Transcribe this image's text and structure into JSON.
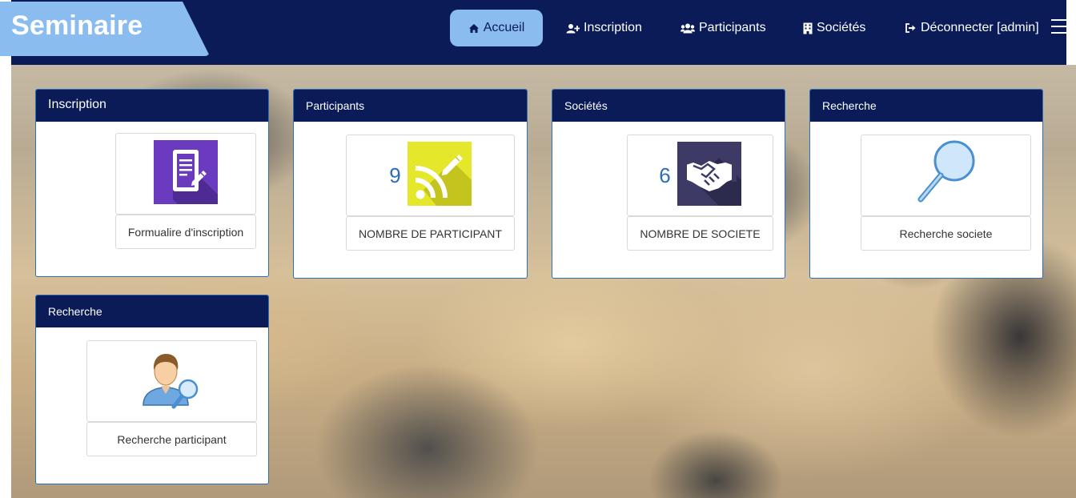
{
  "brand": "Seminaire",
  "nav": {
    "home": "Accueil",
    "inscription": "Inscription",
    "participants": "Participants",
    "societes": "Sociétés",
    "logout": "Déconnecter [admin]"
  },
  "cards": {
    "inscription": {
      "title": "Inscription",
      "label": "Formualire d'inscription"
    },
    "participants": {
      "title": "Participants",
      "count": "9",
      "label": "NOMBRE DE PARTICIPANT"
    },
    "societes": {
      "title": "Sociétés",
      "count": "6",
      "label": "NOMBRE DE SOCIETE"
    },
    "recherche_societe": {
      "title": "Recherche",
      "label": "Recherche societe"
    },
    "recherche_participant": {
      "title": "Recherche",
      "label": "Recherche participant"
    }
  },
  "colors": {
    "navbar": "#0a1b57",
    "brand_bg": "#8bbcef",
    "accent": "#2a6fb8",
    "icon_purple": "#6a3bbf",
    "icon_yellow": "#e5e82a",
    "icon_slate": "#3d3a66"
  },
  "icons": {
    "home": "home-icon",
    "inscription": "user-plus-icon",
    "participants": "users-icon",
    "societes": "building-icon",
    "logout": "sign-out-icon",
    "menu": "hamburger-menu-icon"
  }
}
